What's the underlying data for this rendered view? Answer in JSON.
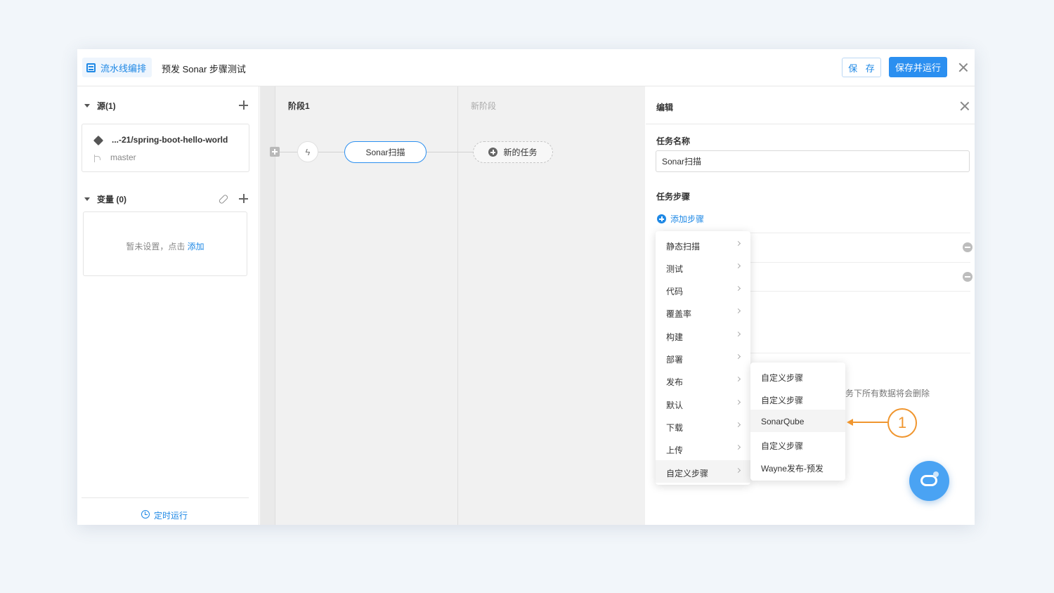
{
  "header": {
    "brand_label": "流水线编排",
    "pipeline_title": "预发 Sonar 步骤测试",
    "save_label": "保 存",
    "save_run_label": "保存并运行"
  },
  "sidebar": {
    "sources_title": "源(1)",
    "source": {
      "repo": "...-21/spring-boot-hello-world",
      "branch": "master"
    },
    "variables_title": "变量 (0)",
    "variables_empty_text": "暂未设置，点击",
    "variables_add_link": "添加",
    "schedule_label": "定时运行"
  },
  "canvas": {
    "stage_title": "阶段1",
    "new_stage_title": "新阶段",
    "trigger_symbol": "ϟ",
    "task_label": "Sonar扫描",
    "new_task_label": "新的任务"
  },
  "panel": {
    "title": "编辑",
    "task_name_label": "任务名称",
    "task_name_value": "Sonar扫描",
    "task_steps_label": "任务步骤",
    "add_step_label": "添加步骤",
    "warning_fragment": "务下所有数据将会删除"
  },
  "step_menu": {
    "items": [
      "静态扫描",
      "测试",
      "代码",
      "覆盖率",
      "构建",
      "部署",
      "发布",
      "默认",
      "下载",
      "上传",
      "自定义步骤"
    ]
  },
  "custom_submenu": {
    "items": [
      "自定义步骤",
      "自定义步骤",
      "SonarQube",
      "自定义步骤",
      "Wayne发布-预发"
    ]
  },
  "annotation": {
    "badge": "1"
  },
  "colors": {
    "accent": "#2b8ff0",
    "annotation": "#f0962f"
  }
}
